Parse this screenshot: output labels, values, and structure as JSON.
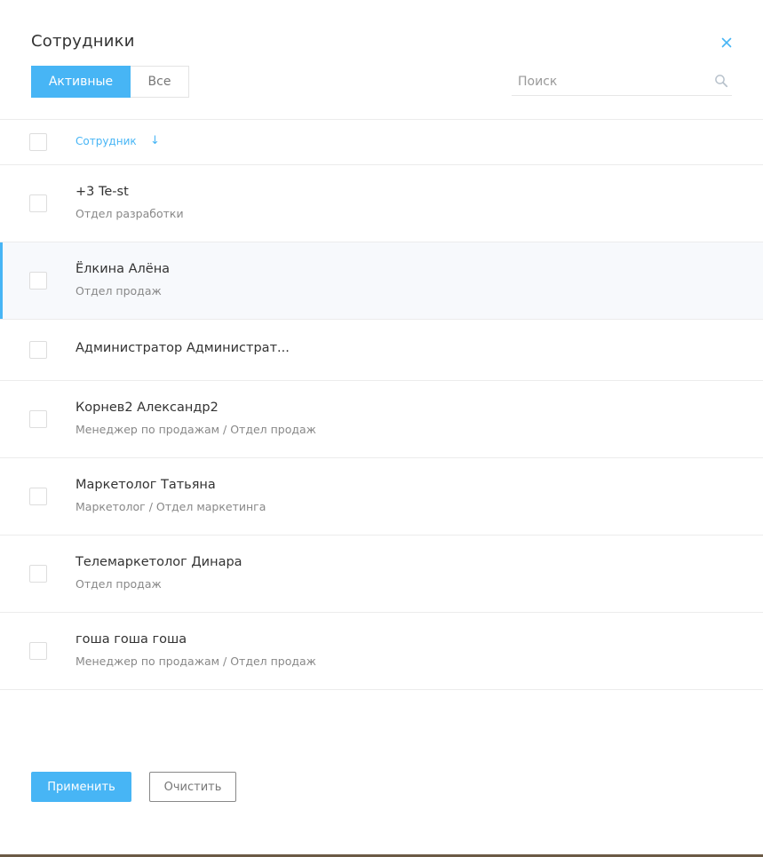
{
  "dialog": {
    "title": "Сотрудники",
    "close_icon": "close-icon"
  },
  "filter_tabs": {
    "active_label": "Активные",
    "all_label": "Все",
    "selected": "Активные"
  },
  "search": {
    "placeholder": "Поиск",
    "value": "",
    "icon": "search-icon"
  },
  "table": {
    "column_header": "Сотрудник",
    "sort_icon": "arrow-down-icon",
    "rows": [
      {
        "name": "+3 Te-st",
        "subtitle": "Отдел разработки",
        "highlighted": false
      },
      {
        "name": "Ёлкина Алёна",
        "subtitle": "Отдел продаж",
        "highlighted": true
      },
      {
        "name": "Администратор Администрат...",
        "subtitle": "",
        "highlighted": false
      },
      {
        "name": "Корнев2 Александр2",
        "subtitle": "Менеджер по продажам / Отдел продаж",
        "highlighted": false
      },
      {
        "name": "Маркетолог Татьяна",
        "subtitle": "Маркетолог / Отдел маркетинга",
        "highlighted": false
      },
      {
        "name": "Телемаркетолог Динара",
        "subtitle": "Отдел продаж",
        "highlighted": false
      },
      {
        "name": "гоша гоша гоша",
        "subtitle": "Менеджер по продажам / Отдел продаж",
        "highlighted": false
      }
    ]
  },
  "actions": {
    "apply_label": "Применить",
    "clear_label": "Очистить"
  },
  "colors": {
    "accent": "#47b5f5",
    "highlight_row_bg": "#f7f9fc",
    "text": "#333333",
    "muted": "#888888"
  }
}
